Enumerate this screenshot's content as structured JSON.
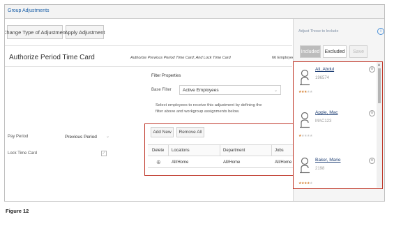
{
  "window": {
    "title": "Group Adjustments"
  },
  "toolbar": {
    "change_type_label": "Change Type of Adjustment",
    "apply_label": "Apply Adjustment"
  },
  "header": {
    "title": "Authorize Period Time Card",
    "subtitle": "Authorize Previous Period Time Card; And Lock Time Card",
    "count": "66 Employees"
  },
  "filter": {
    "title": "Filter Properties",
    "base_filter_label": "Base Filter",
    "base_filter_value": "Active Employees",
    "help_text": "Select employees to receive this adjustment by defining the filter above and workgroup assignments below."
  },
  "options": {
    "pay_period_label": "Pay Period",
    "pay_period_value": "Previous Period",
    "lock_label": "Lock Time Card",
    "lock_checked": true
  },
  "workgroups": {
    "add_new_label": "Add New",
    "remove_all_label": "Remove All",
    "columns": [
      "Delete",
      "Locations",
      "Department",
      "Jobs"
    ],
    "rows": [
      {
        "locations": "All/Home",
        "department": "All/Home",
        "jobs": "All/Home"
      }
    ]
  },
  "panel": {
    "heading": "Adjust Those to Include",
    "tabs": [
      "Included",
      "Excluded",
      "Save"
    ],
    "active_tab": "Included",
    "employees": [
      {
        "name": "Ali, Abdul",
        "id": "196574",
        "rating": 3
      },
      {
        "name": "Apple, Mac",
        "id": "MAC123",
        "rating": 1
      },
      {
        "name": "Baker, Marie",
        "id": "2198",
        "rating": 4
      }
    ],
    "rating_max": 5
  },
  "caption": "Figure 12",
  "colors": {
    "accent_red": "#c0392b",
    "link_blue": "#1a5fa8",
    "star_orange": "#d57d2b"
  },
  "icons": {
    "info": "info-circle-icon",
    "gear": "gear-icon",
    "avatar": "person-outline-icon",
    "delete": "delete-circle-icon",
    "caret": "chevron-down-icon"
  }
}
